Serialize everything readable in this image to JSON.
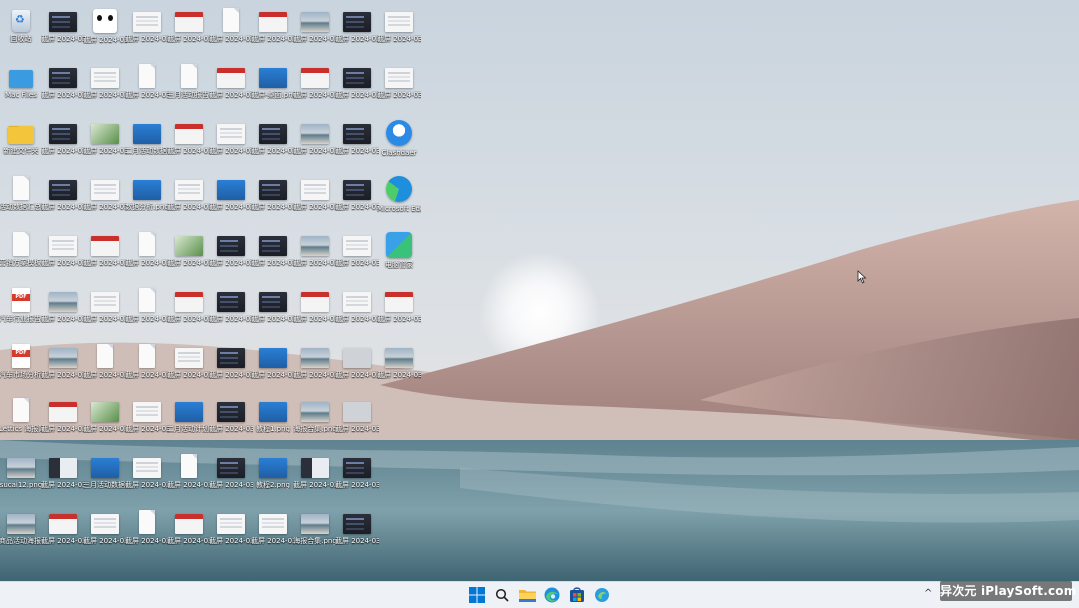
{
  "desktop": {
    "icons": [
      {
        "label": "回收站",
        "kind": "bin"
      },
      {
        "label": "截屏 2024-03-2...",
        "kind": "th-dark"
      },
      {
        "label": "截屏 2024-03-2...",
        "kind": "panda"
      },
      {
        "label": "截屏 2024-03-1...",
        "kind": "th-white"
      },
      {
        "label": "截屏 2024-03-2...",
        "kind": "th-red"
      },
      {
        "label": "截屏 2024-03-2...",
        "kind": "doc"
      },
      {
        "label": "截屏 2024-03-2...",
        "kind": "th-red"
      },
      {
        "label": "截屏 2024-03-2...",
        "kind": "th-land"
      },
      {
        "label": "截屏 2024-03-2...",
        "kind": "th-dark"
      },
      {
        "label": "截屏 2024-03-2...",
        "kind": "th-white"
      },
      {
        "label": "Mac Files",
        "kind": "bluefolder"
      },
      {
        "label": "截屏 2024-03-2...",
        "kind": "th-dark"
      },
      {
        "label": "截屏 2024-03-2...",
        "kind": "th-white"
      },
      {
        "label": "截屏 2024-03-1...",
        "kind": "doc"
      },
      {
        "label": "三月活动报告.pdf",
        "kind": "doc"
      },
      {
        "label": "截屏 2024-03-2...",
        "kind": "th-red"
      },
      {
        "label": "截屏-桌面.png",
        "kind": "th-blue"
      },
      {
        "label": "截屏 2024-03-2...",
        "kind": "th-red"
      },
      {
        "label": "截屏 2024-03-2...",
        "kind": "th-dark"
      },
      {
        "label": "截屏 2024-03-2...",
        "kind": "th-white"
      },
      {
        "label": "新建文件夹",
        "kind": "folder"
      },
      {
        "label": "截屏 2024-03-2...",
        "kind": "th-dark"
      },
      {
        "label": "截屏 2024-03-2...",
        "kind": "th-green"
      },
      {
        "label": "二月活动数据(Downlo...",
        "kind": "th-blue"
      },
      {
        "label": "截屏 2024-03-2...",
        "kind": "th-red"
      },
      {
        "label": "截屏 2024-03-2...",
        "kind": "th-white"
      },
      {
        "label": "截屏 2024-03-2...",
        "kind": "th-dark"
      },
      {
        "label": "截屏 2024-03-2...",
        "kind": "th-land"
      },
      {
        "label": "截屏 2024-03-2...",
        "kind": "th-dark"
      },
      {
        "label": "Clashdaer",
        "kind": "clash"
      },
      {
        "label": "活动数据汇总报告.pptx",
        "kind": "doc"
      },
      {
        "label": "截屏 2024-03-2...",
        "kind": "th-dark"
      },
      {
        "label": "截屏 2024-03-2...",
        "kind": "th-white"
      },
      {
        "label": "数据分析.png",
        "kind": "th-blue"
      },
      {
        "label": "截屏 2024-03-2...",
        "kind": "th-white"
      },
      {
        "label": "截屏 2024-03-2...",
        "kind": "th-blue"
      },
      {
        "label": "截屏 2024-03-2...",
        "kind": "th-dark"
      },
      {
        "label": "截屏 2024-03-2...",
        "kind": "th-white"
      },
      {
        "label": "截屏 2024-03-2...",
        "kind": "th-dark"
      },
      {
        "label": "Microsoft Edge",
        "kind": "edge"
      },
      {
        "label": "营销方案模板.docx",
        "kind": "doc"
      },
      {
        "label": "截屏 2024-03-2...",
        "kind": "th-white"
      },
      {
        "label": "截屏 2024-03-2...",
        "kind": "th-red"
      },
      {
        "label": "截屏 2024-03-2...",
        "kind": "doc"
      },
      {
        "label": "截屏 2024-03-2...",
        "kind": "th-green"
      },
      {
        "label": "截屏 2024-03-2...",
        "kind": "th-dark"
      },
      {
        "label": "截屏 2024-03-2...",
        "kind": "th-dark"
      },
      {
        "label": "截屏 2024-03-2...",
        "kind": "th-land"
      },
      {
        "label": "截屏 2024-03-2...",
        "kind": "th-white"
      },
      {
        "label": "电脑管家",
        "kind": "pcmgr"
      },
      {
        "label": "汽车行业报告.pdf",
        "kind": "pdf"
      },
      {
        "label": "截屏 2024-03-2...",
        "kind": "th-land"
      },
      {
        "label": "截屏 2024-03-2...",
        "kind": "th-white"
      },
      {
        "label": "截屏 2024-03-2...",
        "kind": "doc"
      },
      {
        "label": "截屏 2024-03-2...",
        "kind": "th-red"
      },
      {
        "label": "截屏 2024-03-2...",
        "kind": "th-dark"
      },
      {
        "label": "截屏 2024-03-2...",
        "kind": "th-dark"
      },
      {
        "label": "截屏 2024-03-2...",
        "kind": "th-red"
      },
      {
        "label": "截屏 2024-03-2...",
        "kind": "th-white"
      },
      {
        "label": "截屏 2024-03-2...",
        "kind": "th-red"
      },
      {
        "label": "汽车市场分析报告.pdf",
        "kind": "pdf"
      },
      {
        "label": "截屏 2024-03-2...",
        "kind": "th-land"
      },
      {
        "label": "截屏 2024-03-2...",
        "kind": "doc"
      },
      {
        "label": "截屏 2024-03-2...",
        "kind": "doc"
      },
      {
        "label": "截屏 2024-03-2...",
        "kind": "th-white"
      },
      {
        "label": "截屏 2024-03-2...",
        "kind": "th-dark"
      },
      {
        "label": "截屏 2024-03-2...",
        "kind": "th-blue"
      },
      {
        "label": "截屏 2024-03-2...",
        "kind": "th-land"
      },
      {
        "label": "截屏 2024-03-2...",
        "kind": "th-grey"
      },
      {
        "label": "截屏 2024-03-2...",
        "kind": "th-land"
      },
      {
        "label": "Lettics 海报简介-1500x...",
        "kind": "doc"
      },
      {
        "label": "截屏 2024-03-2...",
        "kind": "th-red"
      },
      {
        "label": "截屏 2024-03-2...",
        "kind": "th-green"
      },
      {
        "label": "截屏 2024-03-2...",
        "kind": "th-white"
      },
      {
        "label": "二月活动计划.png",
        "kind": "th-blue"
      },
      {
        "label": "截屏 2024-03-2...",
        "kind": "th-dark"
      },
      {
        "label": "教程1.png",
        "kind": "th-blue"
      },
      {
        "label": "海报合集.png",
        "kind": "th-land"
      },
      {
        "label": "截屏 2024-03-2...",
        "kind": "th-grey"
      },
      {
        "label": "sucai12.png",
        "kind": "th-land"
      },
      {
        "label": "截屏 2024-03-2...",
        "kind": "th-mix"
      },
      {
        "label": "三月活动数据(Downlo...",
        "kind": "th-blue"
      },
      {
        "label": "截屏 2024-03-2...",
        "kind": "th-white"
      },
      {
        "label": "截屏 2024-03-2...",
        "kind": "doc"
      },
      {
        "label": "截屏 2024-03-2...",
        "kind": "th-dark"
      },
      {
        "label": "教程2.png",
        "kind": "th-blue"
      },
      {
        "label": "截屏 2024-03-2...",
        "kind": "th-mix"
      },
      {
        "label": "截屏 2024-03-2...",
        "kind": "th-dark"
      },
      {
        "label": "商品活动海报.png",
        "kind": "th-land"
      },
      {
        "label": "截屏 2024-03-2...",
        "kind": "th-red"
      },
      {
        "label": "截屏 2024-03-2...",
        "kind": "th-white"
      },
      {
        "label": "截屏 2024-03-2...",
        "kind": "doc"
      },
      {
        "label": "截屏 2024-03-2...",
        "kind": "th-red"
      },
      {
        "label": "截屏 2024-03-2...",
        "kind": "th-white"
      },
      {
        "label": "截屏 2024-03-2...",
        "kind": "th-white"
      },
      {
        "label": "海报合集.png",
        "kind": "th-land"
      },
      {
        "label": "截屏 2024-03-2...",
        "kind": "th-dark"
      }
    ]
  },
  "taskbar": {
    "buttons": [
      {
        "name": "start-button",
        "icon": "windows-icon"
      },
      {
        "name": "search-button",
        "icon": "search-icon"
      },
      {
        "name": "file-explorer-button",
        "icon": "folder-icon"
      },
      {
        "name": "edge-button",
        "icon": "edge-icon"
      },
      {
        "name": "store-button",
        "icon": "store-icon"
      },
      {
        "name": "app-button",
        "icon": "app-icon"
      }
    ],
    "tray_chevron": "^"
  },
  "watermark": "异次元 iPlaySoft.com",
  "colors": {
    "sky_top": "#cdd8e2",
    "sky_mid": "#e6e3e2",
    "dune": "#b99a94",
    "lake": "#4f7584",
    "taskbar": "#eef1f6",
    "accent": "#0067c0"
  }
}
